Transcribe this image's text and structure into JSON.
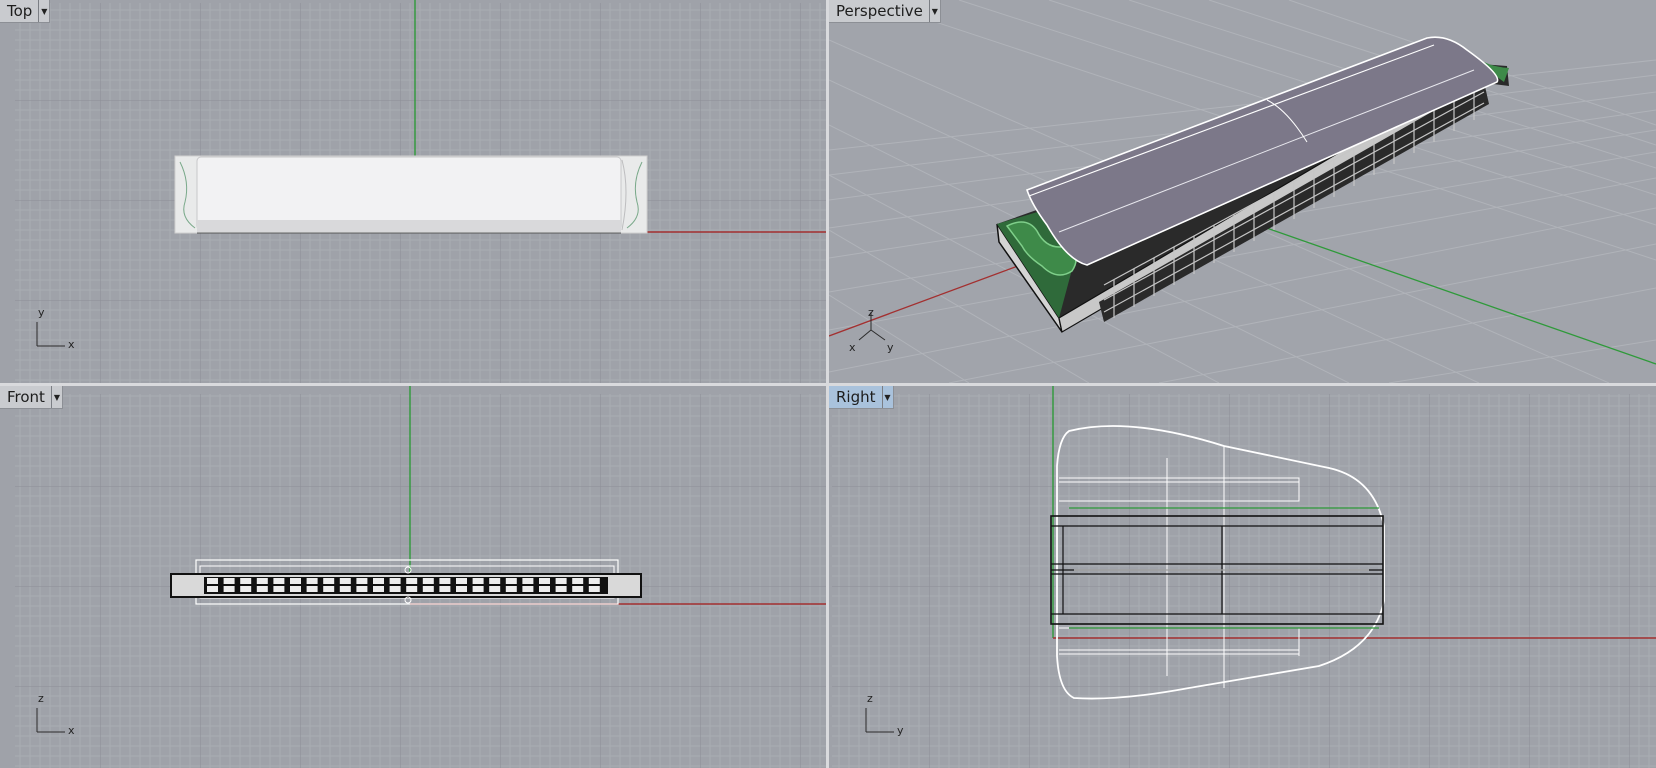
{
  "viewports": {
    "top": {
      "label": "Top",
      "axes": {
        "a": "y",
        "b": "x"
      }
    },
    "persp": {
      "label": "Perspective",
      "axes": {
        "a": "z",
        "b": "x",
        "c": "y"
      }
    },
    "front": {
      "label": "Front",
      "axes": {
        "a": "z",
        "b": "x"
      }
    },
    "right": {
      "label": "Right",
      "axes": {
        "a": "z",
        "b": "y"
      }
    }
  },
  "active_viewport": "Right",
  "icons": {
    "viewport_menu": "chevron-down-icon"
  },
  "colors": {
    "grid_bg": "#9fa2a9",
    "grid_minor": "#a9acb2",
    "grid_major": "#8e9198",
    "x_axis": "#a33030",
    "y_axis": "#2f9a3a",
    "active_tab": "#a9c2dc",
    "model_top": "#7c7889",
    "model_green": "#3e8a49"
  }
}
